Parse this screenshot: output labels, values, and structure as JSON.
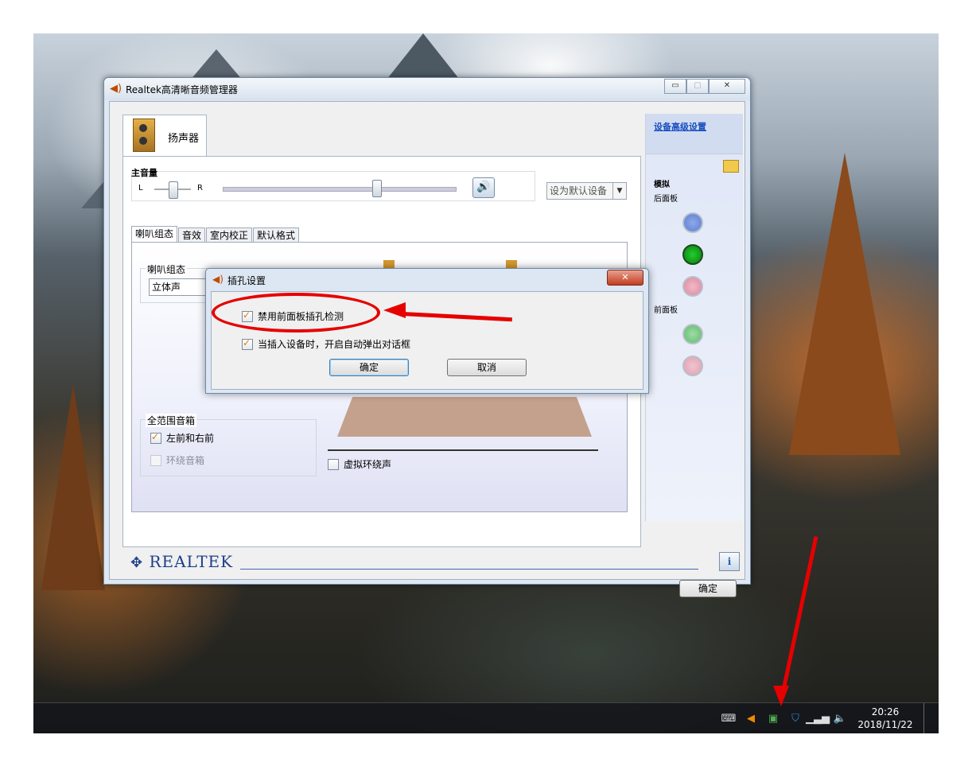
{
  "window": {
    "title": "Realtek高清晰音频管理器",
    "device_tab": "扬声器",
    "master_volume_label": "主音量",
    "left_label": "L",
    "right_label": "R",
    "set_default": "设为默认设备",
    "balance_level": 0.5,
    "volume_level": 0.66,
    "subtabs": [
      "喇叭组态",
      "音效",
      "室内校正",
      "默认格式"
    ],
    "speaker_config_group": "喇叭组态",
    "speaker_config_value": "立体声",
    "fullrange_group": "全范围音箱",
    "fullrange_options": [
      {
        "label": "左前和右前",
        "checked": true,
        "enabled": true
      },
      {
        "label": "环绕音箱",
        "checked": false,
        "enabled": false
      }
    ],
    "virtual_surround": "虚拟环绕声",
    "advanced_link": "设备高级设置",
    "analog_label": "模拟",
    "rear_panel_label": "后面板",
    "front_panel_label": "前面板",
    "brand": "REALTEK",
    "ok_button": "确定"
  },
  "dialog": {
    "title": "插孔设置",
    "options": [
      {
        "label": "禁用前面板插孔检测",
        "checked": true
      },
      {
        "label": "当插入设备时，开启自动弹出对话框",
        "checked": true
      }
    ],
    "ok_button": "确定",
    "cancel_button": "取消"
  },
  "taskbar": {
    "time": "20:26",
    "date": "2018/11/22"
  },
  "colors": {
    "annotation": "#e60000",
    "jack_blue": "#5b7fd0",
    "jack_green": "#0f9a1a",
    "jack_pink": "#e38aa0",
    "jack_green_front": "#5fba6a",
    "jack_pink_front": "#e0a0b0"
  }
}
